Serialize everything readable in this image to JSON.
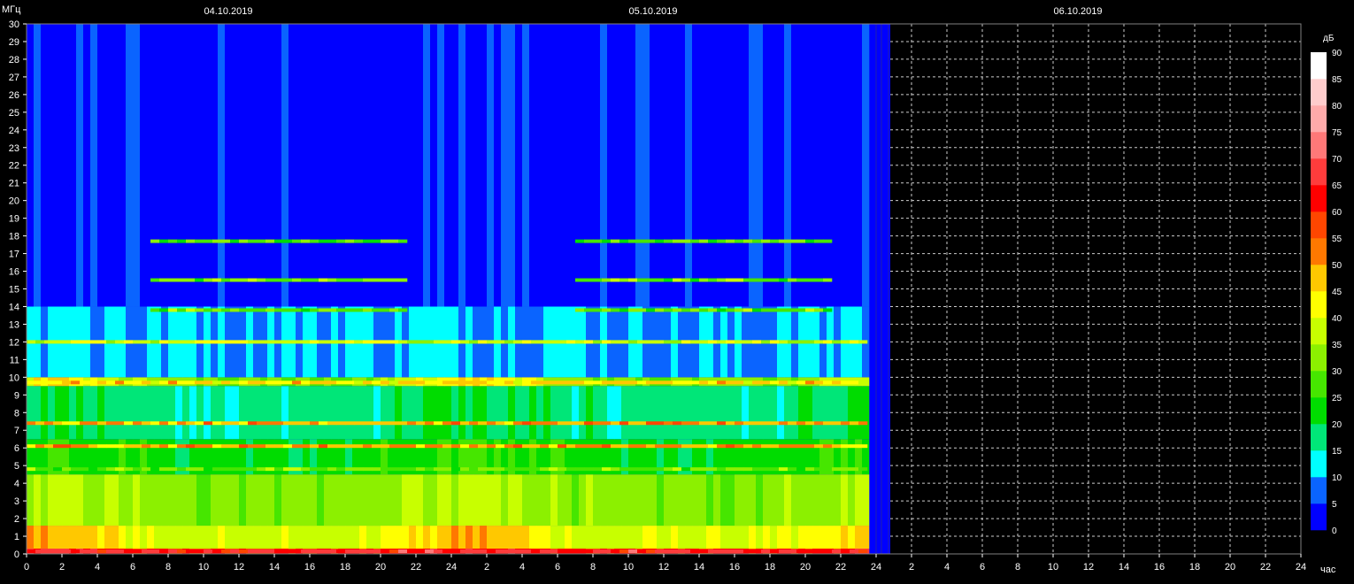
{
  "chart_data": {
    "type": "heatmap",
    "title": "",
    "ylabel": "МГц",
    "xlabel": "час",
    "dates": [
      "04.10.2019",
      "05.10.2019",
      "06.10.2019"
    ],
    "x_days": [
      {
        "date": "04.10.2019",
        "start_hour": 0
      },
      {
        "date": "05.10.2019",
        "start_hour": 24
      },
      {
        "date": "06.10.2019",
        "start_hour": 50
      }
    ],
    "xlim_hours": [
      0,
      72
    ],
    "x_tick_labels": [
      "0",
      "2",
      "4",
      "6",
      "8",
      "10",
      "12",
      "14",
      "16",
      "18",
      "20",
      "22",
      "24",
      "2",
      "4",
      "6",
      "8",
      "10",
      "12",
      "14",
      "16",
      "18",
      "20",
      "22",
      "24",
      "2",
      "4",
      "6",
      "8",
      "10",
      "12",
      "14",
      "16",
      "18",
      "20",
      "22",
      "24"
    ],
    "ylim": [
      0,
      30
    ],
    "y_ticks": [
      0,
      1,
      2,
      3,
      4,
      5,
      6,
      7,
      8,
      9,
      10,
      11,
      12,
      13,
      14,
      15,
      16,
      17,
      18,
      19,
      20,
      21,
      22,
      23,
      24,
      25,
      26,
      27,
      28,
      29,
      30
    ],
    "data_end_hour": 47.2,
    "blank_end_hour": 48.8,
    "grid": "dashed, empty area only",
    "colorbar": {
      "label": "дБ",
      "ticks": [
        0,
        5,
        10,
        15,
        20,
        25,
        30,
        35,
        40,
        45,
        50,
        55,
        60,
        65,
        70,
        75,
        80,
        85,
        90
      ],
      "colors": [
        "#0000ff",
        "#0a64ff",
        "#00ffff",
        "#00e678",
        "#00dc00",
        "#46e600",
        "#8cf000",
        "#c8ff00",
        "#ffff00",
        "#ffc800",
        "#ff7800",
        "#ff4600",
        "#ff0000",
        "#ff3c3c",
        "#ff7878",
        "#ffaaaa",
        "#ffcccc",
        "#ffffff"
      ]
    },
    "bands": [
      {
        "fmin": 0.0,
        "fmax": 0.3,
        "level_day": 60,
        "level_night": 65
      },
      {
        "fmin": 0.3,
        "fmax": 1.6,
        "level_day": 38,
        "level_night": 50
      },
      {
        "fmin": 1.6,
        "fmax": 4.5,
        "level_day": 32,
        "level_night": 36
      },
      {
        "fmin": 4.5,
        "fmax": 6.5,
        "level_day": 22,
        "level_night": 26
      },
      {
        "fmin": 6.5,
        "fmax": 9.5,
        "level_day": 17,
        "level_night": 20
      },
      {
        "fmin": 9.5,
        "fmax": 10.0,
        "level_day": 30,
        "level_night": 45
      },
      {
        "fmin": 10.0,
        "fmax": 14.0,
        "level_day": 10,
        "level_night": 12
      },
      {
        "fmin": 14.0,
        "fmax": 30.0,
        "level_day": 3,
        "level_night": 3
      }
    ],
    "lines": [
      {
        "f": 0.15,
        "level": 65
      },
      {
        "f": 4.8,
        "level": 30
      },
      {
        "f": 6.1,
        "level": 50
      },
      {
        "f": 7.4,
        "level": 50
      },
      {
        "f": 9.7,
        "level": 45
      },
      {
        "f": 12.0,
        "level": 38
      },
      {
        "f": 13.8,
        "level": 30
      },
      {
        "f": 15.5,
        "level": 30
      },
      {
        "f": 17.7,
        "level": 28
      }
    ]
  }
}
